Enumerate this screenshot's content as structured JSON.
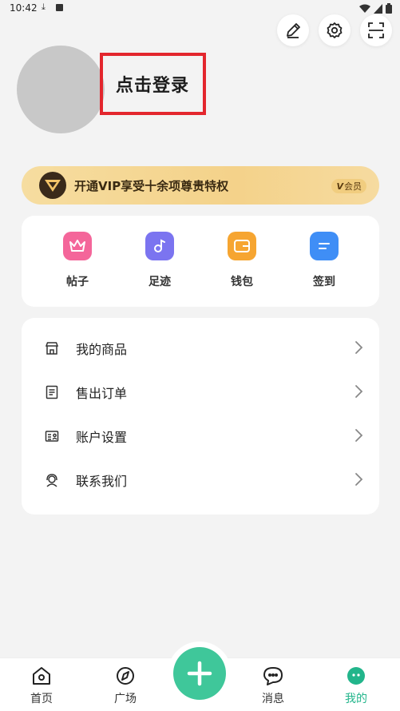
{
  "status_bar": {
    "time": "10:42",
    "icons": [
      "download-icon",
      "app-notification-icon",
      "wifi-icon",
      "signal-icon",
      "battery-icon"
    ]
  },
  "top_actions": [
    "edit-icon",
    "settings-icon",
    "scan-icon"
  ],
  "profile": {
    "login_text": "点击登录"
  },
  "vip": {
    "text": "开通VIP享受十余项尊贵特权",
    "badge_v": "V",
    "badge_text": "会员"
  },
  "quick": {
    "items": [
      {
        "label": "帖子",
        "icon": "crown-icon",
        "color": "#f4669a"
      },
      {
        "label": "足迹",
        "icon": "music-note-icon",
        "color": "#7b74f0"
      },
      {
        "label": "钱包",
        "icon": "wallet-icon",
        "color": "#f6a531"
      },
      {
        "label": "签到",
        "icon": "checkin-icon",
        "color": "#3f8ef6"
      }
    ]
  },
  "menu": {
    "items": [
      {
        "label": "我的商品",
        "icon": "store-icon"
      },
      {
        "label": "售出订单",
        "icon": "order-icon"
      },
      {
        "label": "账户设置",
        "icon": "id-card-icon"
      },
      {
        "label": "联系我们",
        "icon": "support-agent-icon"
      }
    ]
  },
  "nav": {
    "items": [
      {
        "label": "首页",
        "icon": "home-icon"
      },
      {
        "label": "广场",
        "icon": "compass-icon"
      },
      {
        "label": "消息",
        "icon": "chat-icon"
      },
      {
        "label": "我的",
        "icon": "profile-face-icon",
        "active": true
      }
    ],
    "fab_icon": "plus-icon",
    "accent": "#22b58b"
  }
}
